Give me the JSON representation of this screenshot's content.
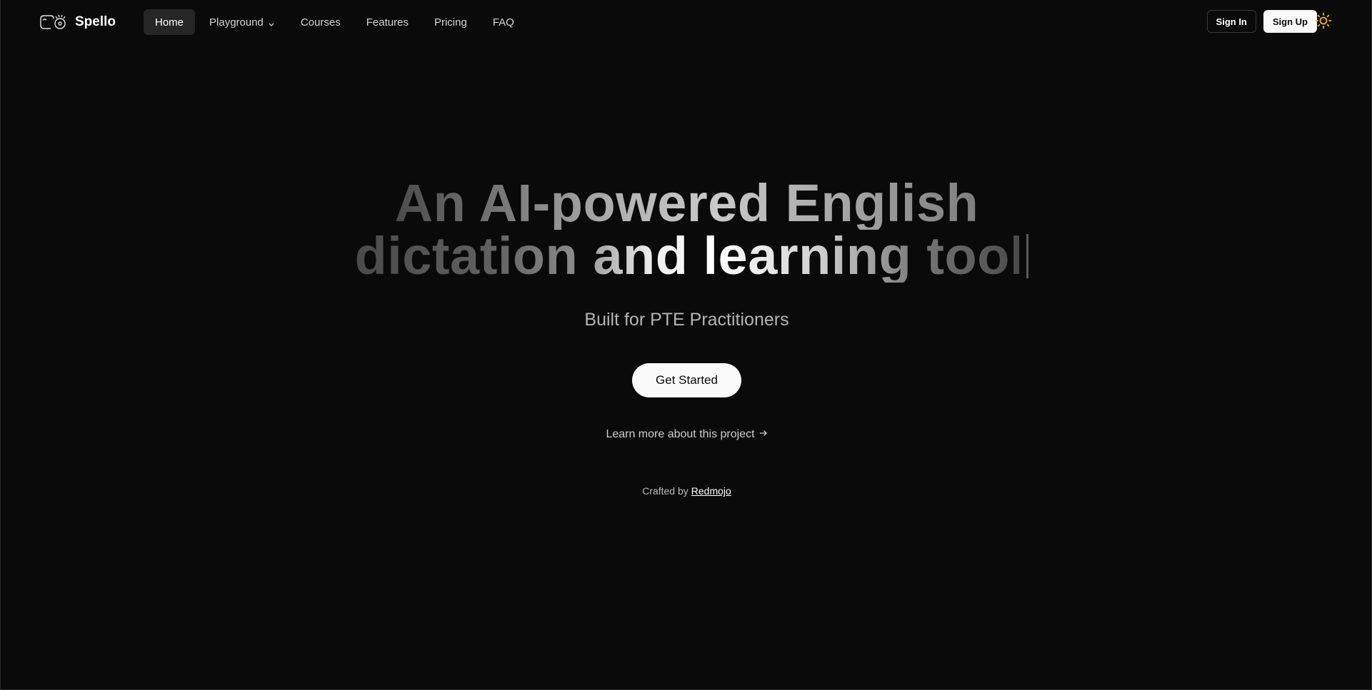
{
  "brand": {
    "name": "Spello",
    "logo_icon": "spello-logo-icon"
  },
  "nav": {
    "items": [
      {
        "label": "Home",
        "active": true
      },
      {
        "label": "Playground",
        "has_dropdown": true
      },
      {
        "label": "Courses"
      },
      {
        "label": "Features"
      },
      {
        "label": "Pricing"
      },
      {
        "label": "FAQ"
      }
    ]
  },
  "auth": {
    "sign_in": "Sign In",
    "sign_up": "Sign Up"
  },
  "theme_toggle": {
    "icon": "sun-icon",
    "color": "#f5b700"
  },
  "hero": {
    "headline_line1": "An AI-powered English",
    "headline_line2": "dictation and learning tool",
    "subtitle": "Built for PTE Practitioners",
    "cta": "Get Started",
    "learn_more": "Learn more about this project",
    "learn_more_icon": "arrow-right-icon",
    "crafted_prefix": "Crafted by",
    "crafted_link": "Redmojo"
  },
  "colors": {
    "background": "#0a0a0a",
    "primary_button_bg": "#fafafa",
    "accent_sun": "#f5b700"
  }
}
